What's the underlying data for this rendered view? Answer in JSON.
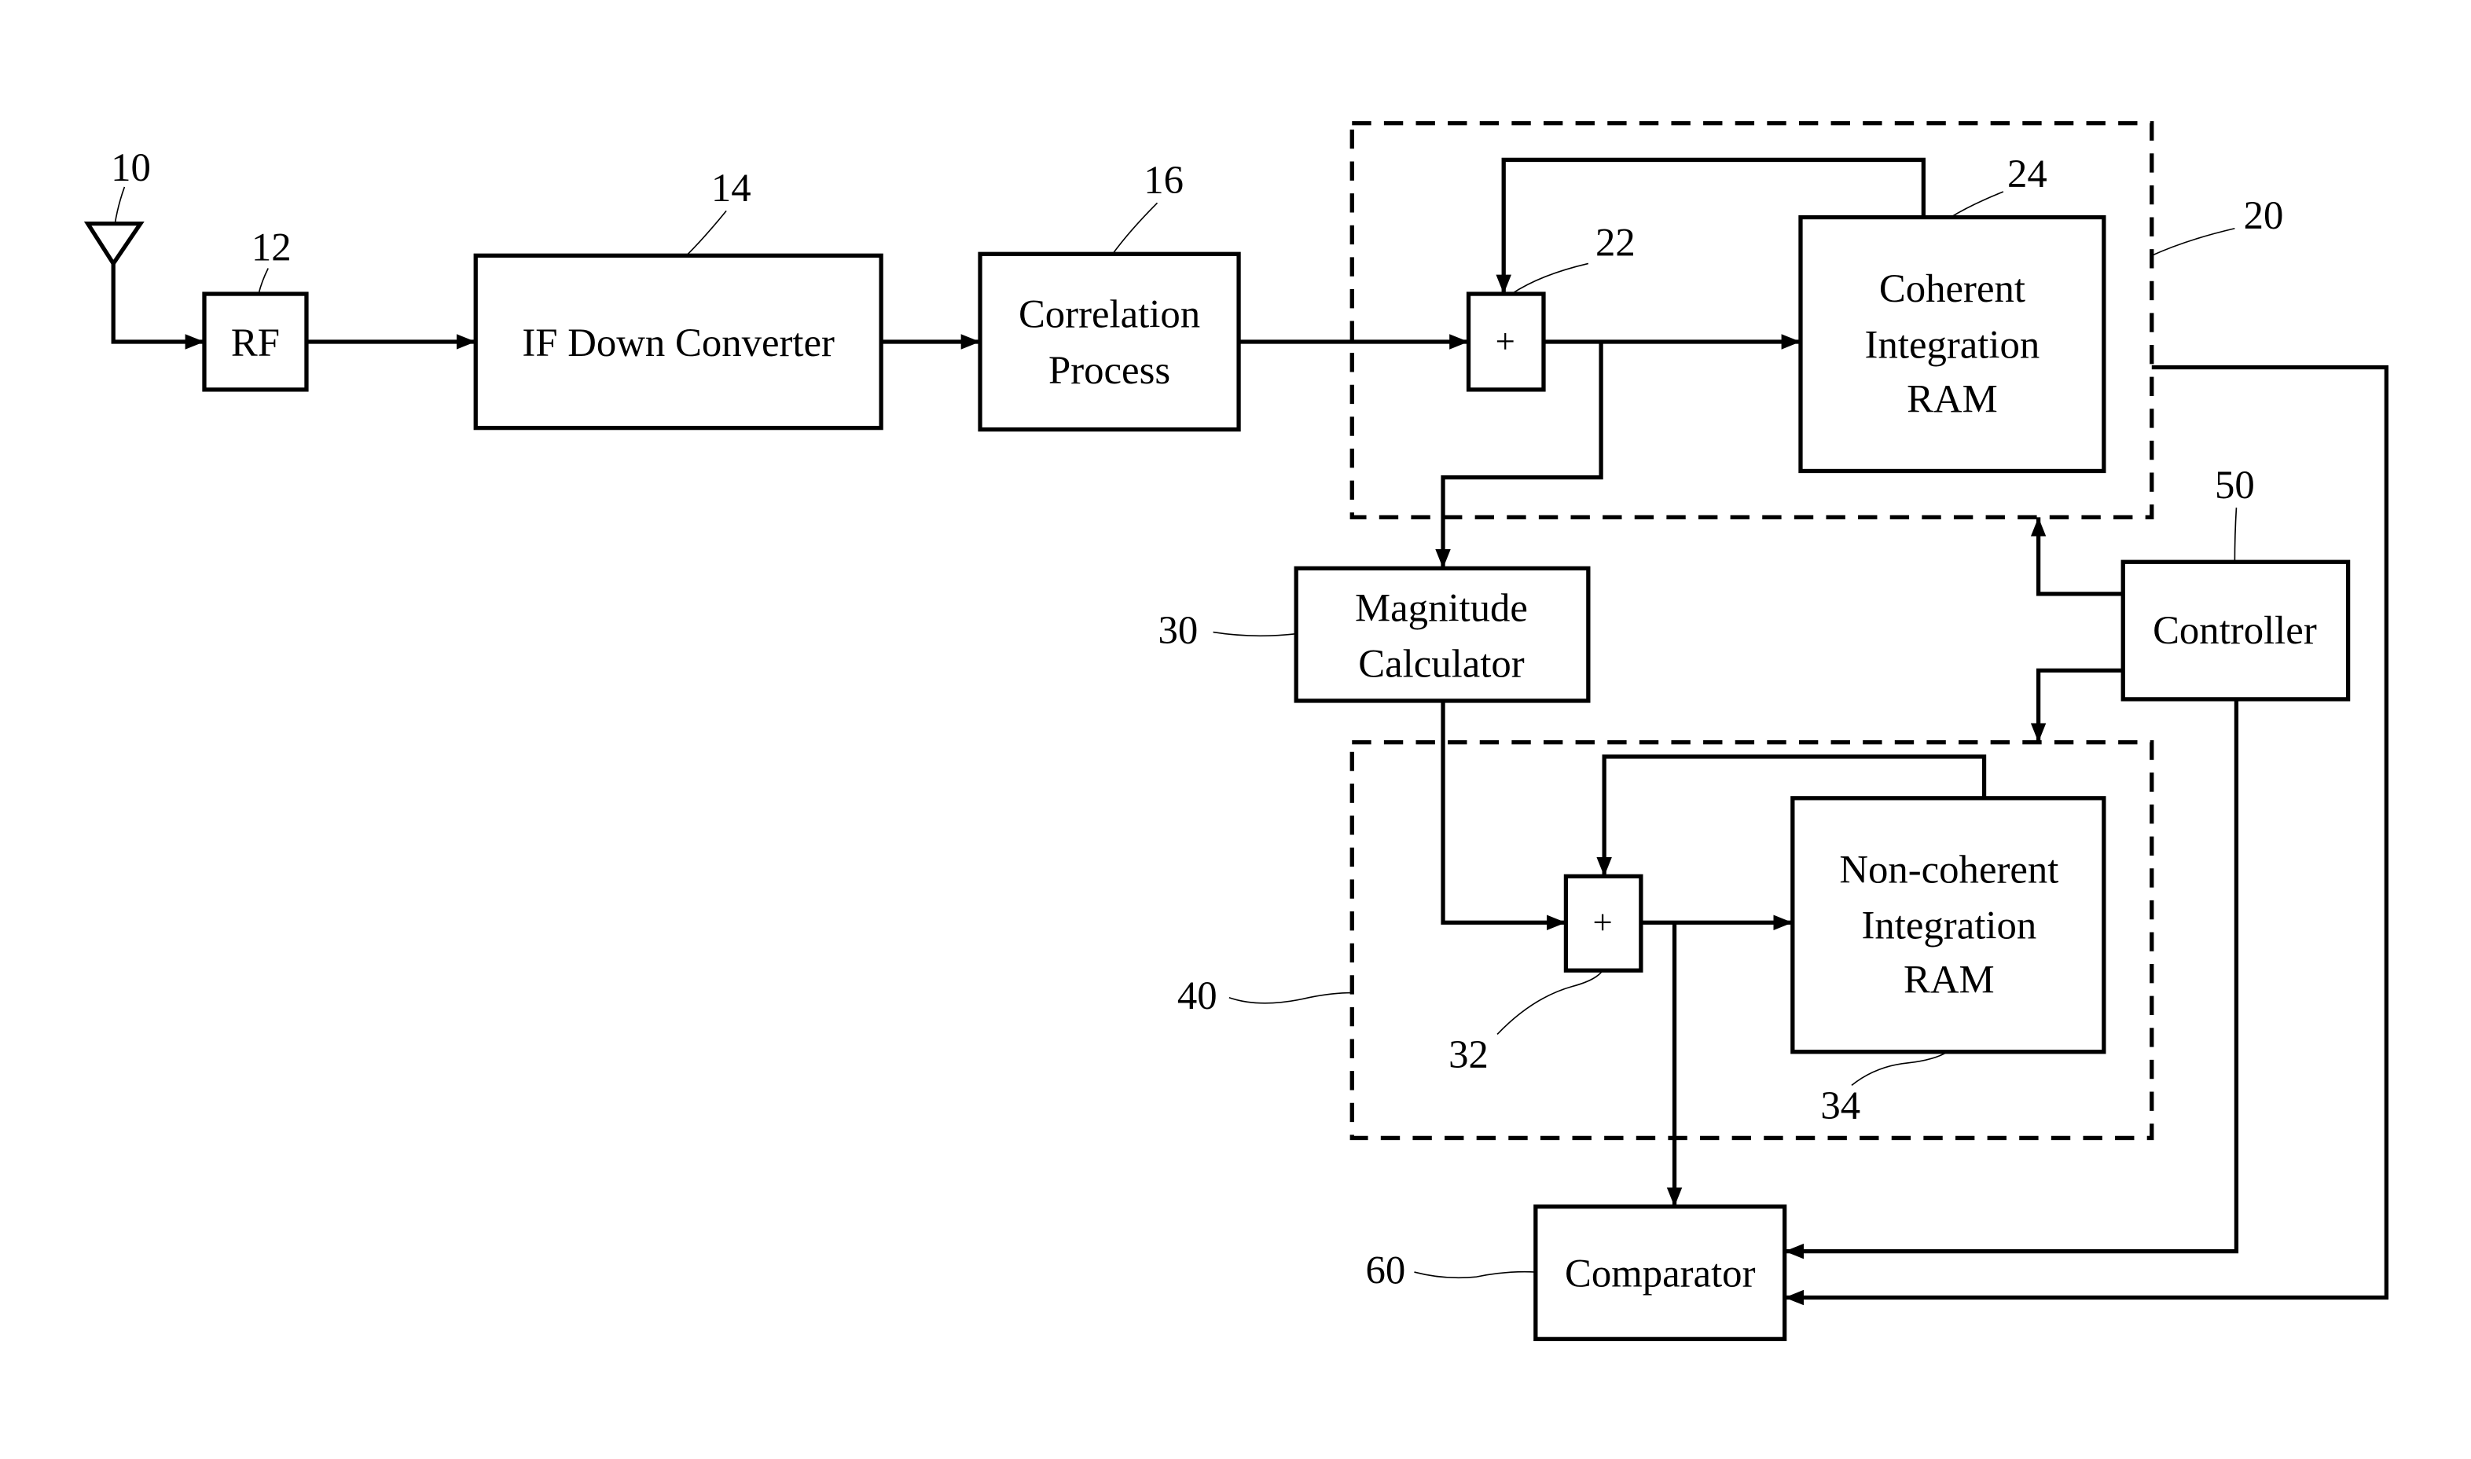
{
  "diagram": {
    "blocks": {
      "antenna": {
        "ref": "10"
      },
      "rf": {
        "label": "RF",
        "ref": "12"
      },
      "if_down_converter": {
        "label": "IF Down Converter",
        "ref": "14"
      },
      "correlation_process": {
        "line1": "Correlation",
        "line2": "Process",
        "ref": "16"
      },
      "coherent_group": {
        "ref": "20"
      },
      "coherent_adder": {
        "symbol": "+",
        "ref": "22"
      },
      "coherent_ram": {
        "line1": "Coherent",
        "line2": "Integration",
        "line3": "RAM",
        "ref": "24"
      },
      "magnitude_calculator": {
        "line1": "Magnitude",
        "line2": "Calculator",
        "ref": "30"
      },
      "noncoherent_adder": {
        "symbol": "+",
        "ref": "32"
      },
      "noncoherent_ram": {
        "line1": "Non-coherent",
        "line2": "Integration",
        "line3": "RAM",
        "ref": "34"
      },
      "noncoherent_group": {
        "ref": "40"
      },
      "controller": {
        "label": "Controller",
        "ref": "50"
      },
      "comparator": {
        "label": "Comparator",
        "ref": "60"
      }
    }
  }
}
